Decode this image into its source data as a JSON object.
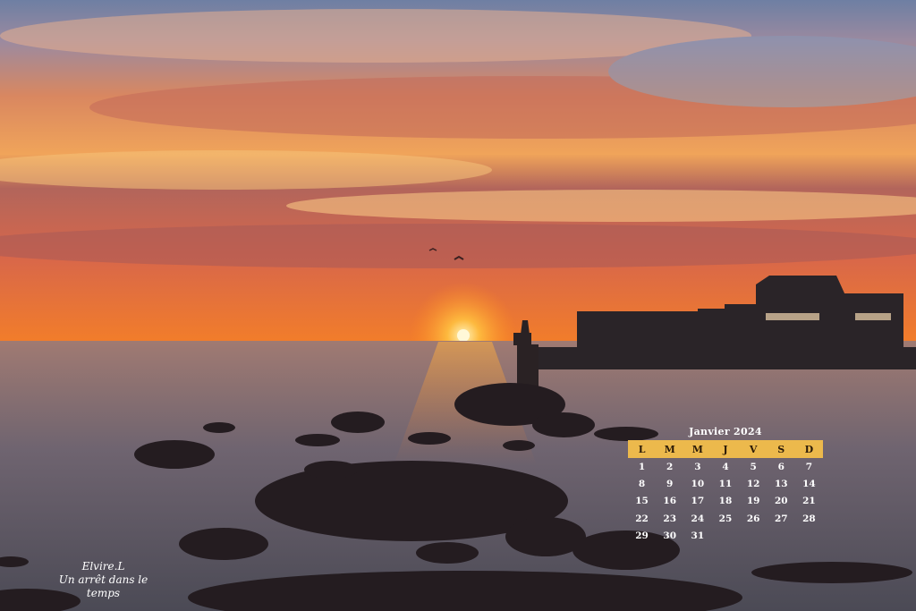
{
  "photo": {
    "description_icons": [
      "sun-icon",
      "lighthouse-icon",
      "bird-icon"
    ]
  },
  "calendar": {
    "title": "Janvier 2024",
    "weekdays": [
      "L",
      "M",
      "M",
      "J",
      "V",
      "S",
      "D"
    ],
    "weeks": [
      [
        "1",
        "2",
        "3",
        "4",
        "5",
        "6",
        "7"
      ],
      [
        "8",
        "9",
        "10",
        "11",
        "12",
        "13",
        "14"
      ],
      [
        "15",
        "16",
        "17",
        "18",
        "19",
        "20",
        "21"
      ],
      [
        "22",
        "23",
        "24",
        "25",
        "26",
        "27",
        "28"
      ],
      [
        "29",
        "30",
        "31",
        "",
        "",
        "",
        ""
      ]
    ],
    "header_color": "#ecb94c"
  },
  "signature": {
    "name": "Elvire.L",
    "tagline": "Un arrêt dans le temps"
  }
}
